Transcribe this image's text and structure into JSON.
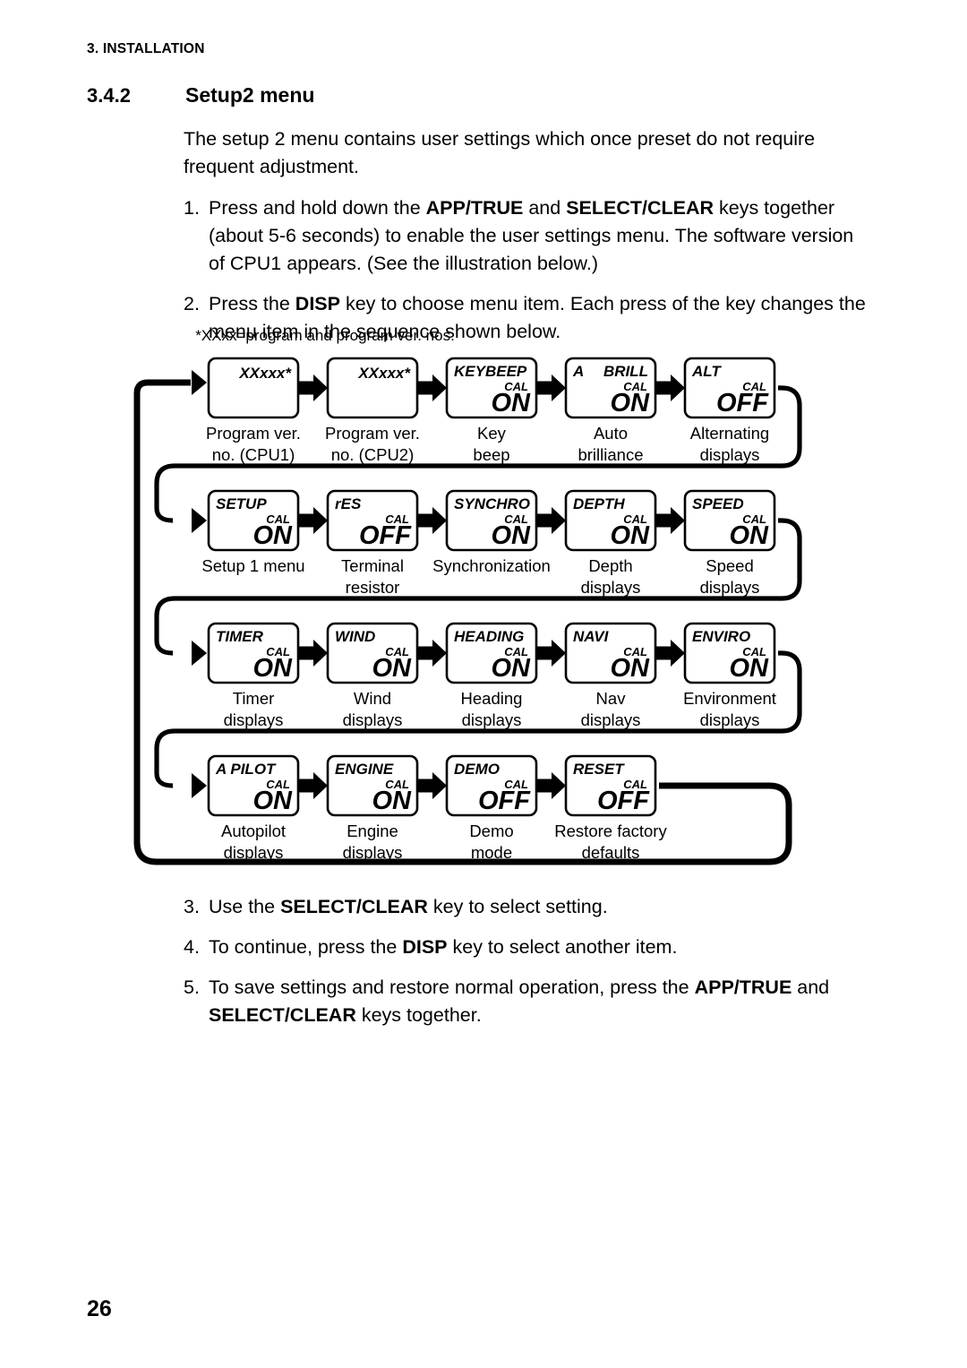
{
  "header": {
    "running_head": "3. INSTALLATION"
  },
  "section": {
    "number": "3.4.2",
    "title": "Setup2 menu"
  },
  "intro": {
    "text": "The setup 2 menu contains user settings which once preset do not require frequent adjustment."
  },
  "steps_top": [
    {
      "num": "1.",
      "segments": [
        {
          "text": "Press and hold down the ",
          "bold": false
        },
        {
          "text": "APP/TRUE",
          "bold": true
        },
        {
          "text": " and ",
          "bold": false
        },
        {
          "text": "SELECT/CLEAR",
          "bold": true
        },
        {
          "text": " keys together (about 5-6 seconds) to enable the user settings menu. The software version of CPU1 appears. (See the illustration below.)",
          "bold": false
        }
      ]
    },
    {
      "num": "2.",
      "segments": [
        {
          "text": "Press the ",
          "bold": false
        },
        {
          "text": "DISP",
          "bold": true
        },
        {
          "text": " key to choose menu item. Each press of the key changes the menu item in the sequence shown below.",
          "bold": false
        }
      ]
    }
  ],
  "steps_bottom": [
    {
      "num": "3.",
      "segments": [
        {
          "text": "Use the ",
          "bold": false
        },
        {
          "text": "SELECT/CLEAR",
          "bold": true
        },
        {
          "text": " key to select setting.",
          "bold": false
        }
      ]
    },
    {
      "num": "4.",
      "segments": [
        {
          "text": "To continue, press the ",
          "bold": false
        },
        {
          "text": "DISP",
          "bold": true
        },
        {
          "text": " key to select another item.",
          "bold": false
        }
      ]
    },
    {
      "num": "5.",
      "segments": [
        {
          "text": "To save settings and restore normal operation, press the ",
          "bold": false
        },
        {
          "text": "APP/TRUE",
          "bold": true
        },
        {
          "text": " and ",
          "bold": false
        },
        {
          "text": "SELECT/CLEAR",
          "bold": true
        },
        {
          "text": " keys together.",
          "bold": false
        }
      ]
    }
  ],
  "diagram": {
    "footnote": "*XXxx=program and program ver. nos.",
    "rows": [
      {
        "items": [
          {
            "title": "XXxxx*",
            "title_align": "right",
            "cal": "",
            "value": "",
            "caption": [
              "Program ver.",
              "no. (CPU1)"
            ]
          },
          {
            "title": "XXxxx*",
            "title_align": "right",
            "cal": "",
            "value": "",
            "caption": [
              "Program ver.",
              "no. (CPU2)"
            ]
          },
          {
            "title": "KEYBEEP",
            "title_align": "left",
            "cal": "CAL",
            "value": "ON",
            "caption": [
              "Key",
              "beep"
            ]
          },
          {
            "title": "BRILL",
            "title_prefix": "A",
            "title_align": "center",
            "cal": "CAL",
            "value": "ON",
            "caption": [
              "Auto",
              "brilliance"
            ]
          },
          {
            "title": "ALT",
            "title_align": "left",
            "cal": "CAL",
            "value": "OFF",
            "caption": [
              "Alternating",
              "displays"
            ]
          }
        ]
      },
      {
        "items": [
          {
            "title": "SETUP",
            "title_align": "left",
            "cal": "CAL",
            "value": "ON",
            "caption": [
              "Setup 1 menu",
              ""
            ]
          },
          {
            "title": "rES",
            "title_align": "left",
            "cal": "CAL",
            "value": "OFF",
            "caption": [
              "Terminal",
              "resistor"
            ]
          },
          {
            "title": "SYNCHRO",
            "title_align": "left",
            "cal": "CAL",
            "value": "ON",
            "caption": [
              "Synchronization",
              ""
            ]
          },
          {
            "title": "DEPTH",
            "title_align": "left",
            "cal": "CAL",
            "value": "ON",
            "caption": [
              "Depth",
              "displays"
            ]
          },
          {
            "title": "SPEED",
            "title_align": "left",
            "cal": "CAL",
            "value": "ON",
            "caption": [
              "Speed",
              "displays"
            ]
          }
        ]
      },
      {
        "items": [
          {
            "title": "TIMER",
            "title_align": "left",
            "cal": "CAL",
            "value": "ON",
            "caption": [
              "Timer",
              "displays"
            ]
          },
          {
            "title": "WIND",
            "title_align": "left",
            "cal": "CAL",
            "value": "ON",
            "caption": [
              "Wind",
              "displays"
            ]
          },
          {
            "title": "HEADING",
            "title_align": "left",
            "cal": "CAL",
            "value": "ON",
            "caption": [
              "Heading",
              "displays"
            ]
          },
          {
            "title": "NAVI",
            "title_align": "left",
            "cal": "CAL",
            "value": "ON",
            "caption": [
              "Nav",
              "displays"
            ]
          },
          {
            "title": "ENVIRO",
            "title_align": "left",
            "cal": "CAL",
            "value": "ON",
            "caption": [
              "Environment",
              "displays"
            ]
          }
        ]
      },
      {
        "items": [
          {
            "title": "A PILOT",
            "title_align": "left",
            "cal": "CAL",
            "value": "ON",
            "caption": [
              "Autopilot",
              "displays"
            ]
          },
          {
            "title": "ENGINE",
            "title_align": "left",
            "cal": "CAL",
            "value": "ON",
            "caption": [
              "Engine",
              "displays"
            ]
          },
          {
            "title": "DEMO",
            "title_align": "left",
            "cal": "CAL",
            "value": "OFF",
            "caption": [
              "Demo",
              "mode"
            ]
          },
          {
            "title": "RESET",
            "title_align": "left",
            "cal": "CAL",
            "value": "OFF",
            "caption": [
              "Restore factory",
              "defaults"
            ]
          }
        ]
      }
    ]
  },
  "footer": {
    "page_number": "26"
  }
}
